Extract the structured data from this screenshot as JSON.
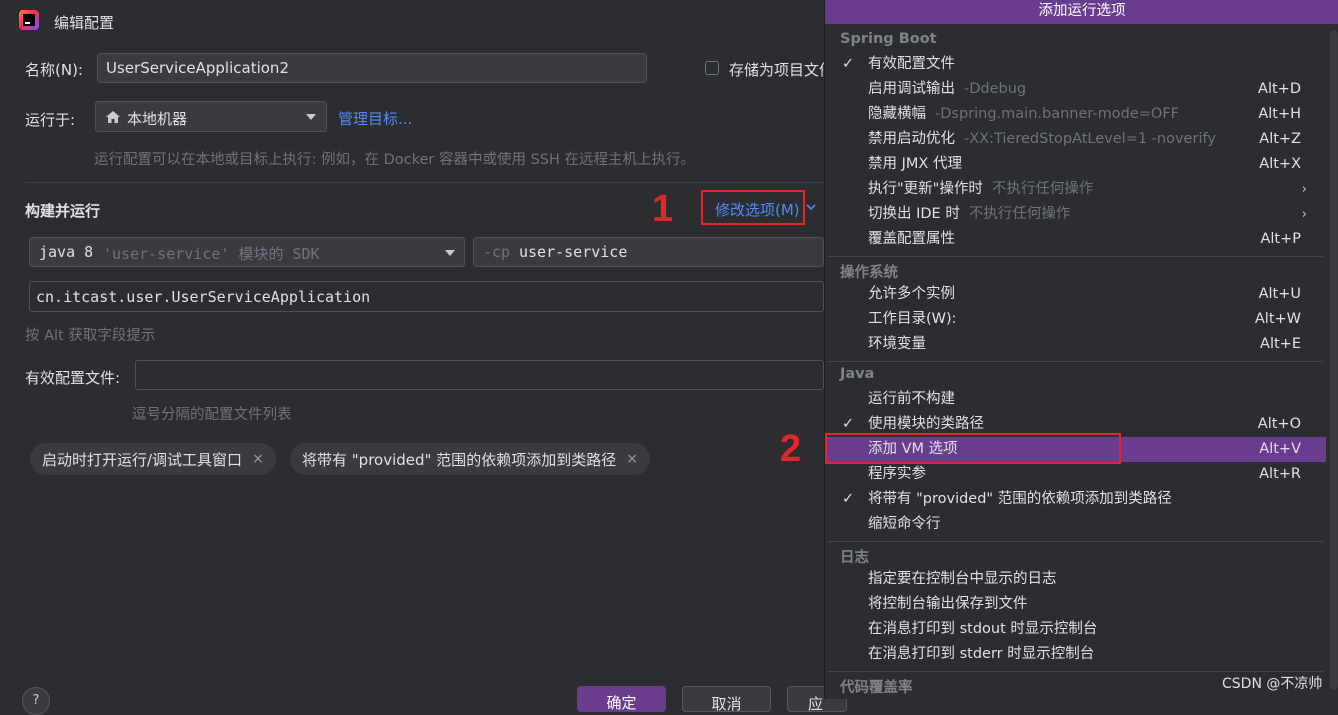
{
  "dialog": {
    "title": "编辑配置",
    "name_label": "名称(N):",
    "name_value": "UserServiceApplication2",
    "store_as_project_file": "存储为项目文件",
    "run_on_label": "运行于:",
    "run_on_value": "本地机器",
    "manage_targets": "管理目标...",
    "run_on_hint": "运行配置可以在本地或目标上执行: 例如，在 Docker 容器中或使用 SSH 在远程主机上执行。",
    "build_run_label": "构建并运行",
    "modify_options": "修改选项(M)",
    "sdk_value_prefix": "java 8",
    "sdk_value_suffix": "'user-service' 模块的 SDK",
    "cp_flag": "-cp",
    "cp_value": "user-service",
    "main_class": "cn.itcast.user.UserServiceApplication",
    "alt_hint": "按 Alt 获取字段提示",
    "active_profiles_label": "有效配置文件:",
    "active_profiles_hint": "逗号分隔的配置文件列表",
    "chips": [
      "启动时打开运行/调试工具窗口",
      "将带有 \"provided\" 范围的依赖项添加到类路径"
    ],
    "chip_close": "×",
    "ok_button": "确定",
    "cancel_button": "取消",
    "apply_button": "应",
    "help_icon": "?",
    "annotation_1": "1",
    "annotation_2": "2"
  },
  "menu": {
    "header": "添加运行选项",
    "groups": {
      "spring_boot": "Spring Boot",
      "os": "操作系统",
      "java": "Java",
      "logs": "日志",
      "coverage": "代码覆盖率"
    },
    "items": [
      {
        "label": "有效配置文件",
        "checked": true
      },
      {
        "label": "启用调试输出",
        "sub": "-Ddebug",
        "shortcut": "Alt+D"
      },
      {
        "label": "隐藏横幅",
        "sub": "-Dspring.main.banner-mode=OFF",
        "shortcut": "Alt+H"
      },
      {
        "label": "禁用启动优化",
        "sub": "-XX:TieredStopAtLevel=1 -noverify",
        "shortcut": "Alt+Z"
      },
      {
        "label": "禁用 JMX 代理",
        "shortcut": "Alt+X"
      },
      {
        "label": "执行\"更新\"操作时",
        "sub": "不执行任何操作",
        "arrow": "›"
      },
      {
        "label": "切换出 IDE 时",
        "sub": "不执行任何操作",
        "arrow": "›"
      },
      {
        "label": "覆盖配置属性",
        "shortcut": "Alt+P"
      },
      {
        "label": "允许多个实例",
        "shortcut": "Alt+U"
      },
      {
        "label": "工作目录(W):",
        "shortcut": "Alt+W"
      },
      {
        "label": "环境变量",
        "shortcut": "Alt+E"
      },
      {
        "label": "运行前不构建"
      },
      {
        "label": "使用模块的类路径",
        "checked": true,
        "shortcut": "Alt+O"
      },
      {
        "label": "添加 VM 选项",
        "shortcut": "Alt+V",
        "selected": true
      },
      {
        "label": "程序实参",
        "shortcut": "Alt+R"
      },
      {
        "label": "将带有 \"provided\" 范围的依赖项添加到类路径",
        "checked": true
      },
      {
        "label": "缩短命令行"
      },
      {
        "label": "指定要在控制台中显示的日志"
      },
      {
        "label": "将控制台输出保存到文件"
      },
      {
        "label": "在消息打印到 stdout 时显示控制台"
      },
      {
        "label": "在消息打印到 stderr 时显示控制台"
      }
    ],
    "check_glyph": "✓"
  },
  "watermark": "CSDN @不凉帅",
  "colors": {
    "background": "#2b2d30",
    "accent_purple": "#6a3c8e",
    "link_blue": "#548af7",
    "annotation_red": "#e5252a"
  }
}
